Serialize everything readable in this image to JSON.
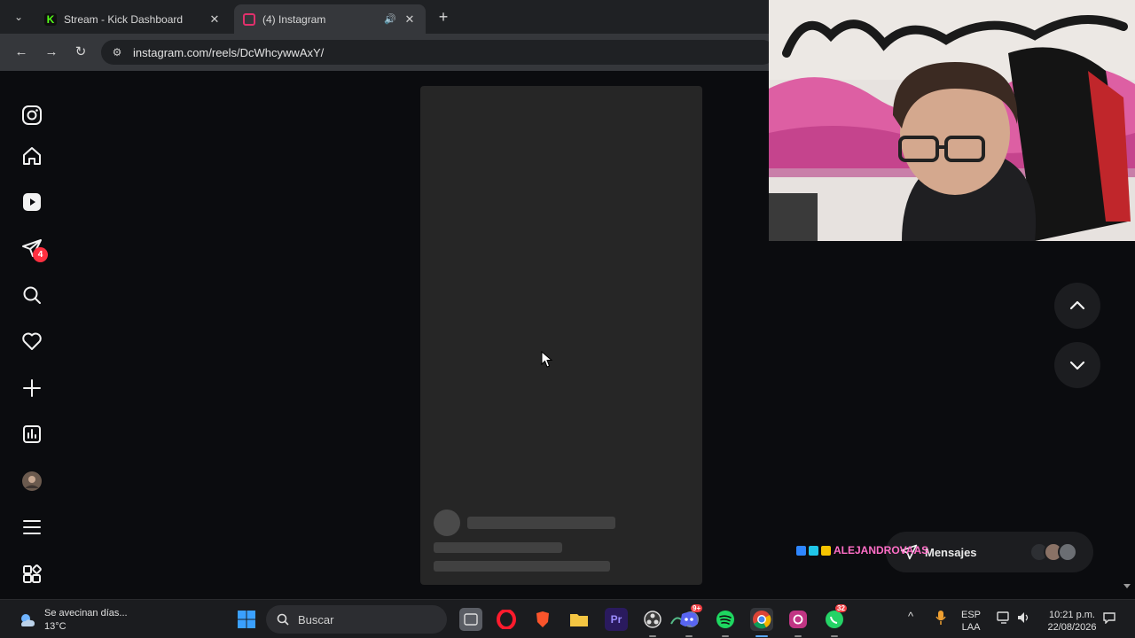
{
  "browser": {
    "tabs": [
      {
        "label": "Stream - Kick Dashboard",
        "icon": "kick-logo-icon"
      },
      {
        "label": "(4) Instagram",
        "icon": "instagram-logo-icon",
        "active": true
      }
    ],
    "address": "instagram.com/reels/DcWhcywwAxY/"
  },
  "sidebar": {
    "notification_count": "4",
    "items": [
      "instagram-logo-icon",
      "home-icon",
      "reels-icon",
      "messages-icon",
      "search-icon",
      "notifications-icon",
      "create-icon",
      "dashboard-icon",
      "profile-avatar",
      "menu-icon",
      "more-apps-icon"
    ]
  },
  "messages": {
    "label": "Mensajes"
  },
  "stream_overlay": {
    "chat_username": "ALEJANDROVAAS"
  },
  "taskbar": {
    "weather_text": "Se avecinan días...",
    "temperature": "13°C",
    "search_placeholder": "Buscar",
    "lang_top": "ESP",
    "lang_bottom": "LAA",
    "time": "10:21 p.m.",
    "date": "22/08/2026",
    "discord_badge": "9+",
    "whatsapp_badge": "32"
  },
  "colors": {
    "accent": "#ff3040",
    "kick_green": "#53fc18"
  }
}
